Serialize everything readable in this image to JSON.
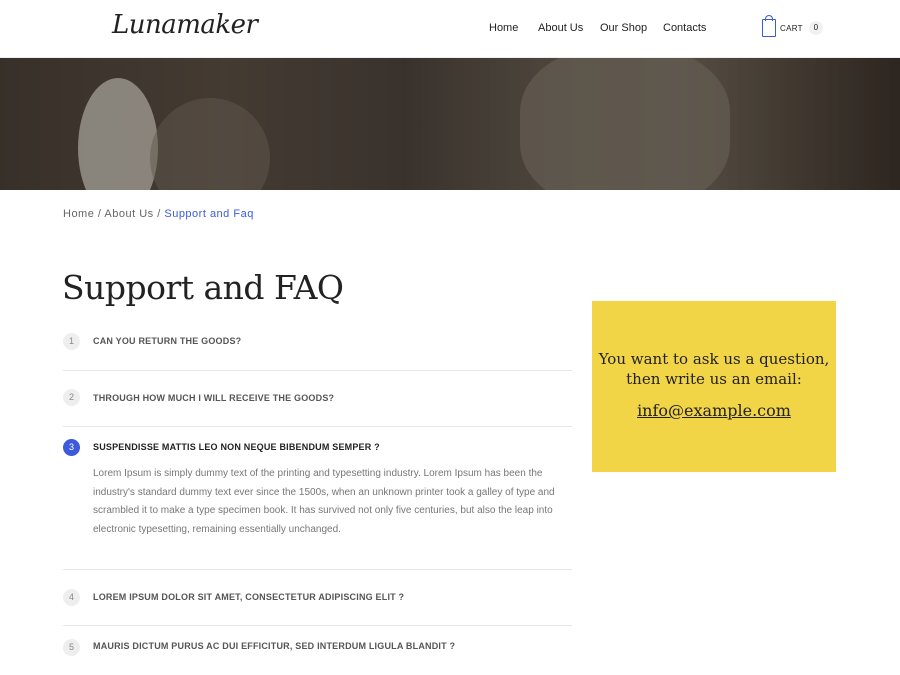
{
  "header": {
    "logo": "Lunamaker",
    "nav": [
      "Home",
      "About Us",
      "Our Shop",
      "Contacts"
    ],
    "cart_label": "CART",
    "cart_count": "0"
  },
  "breadcrumb": {
    "home": "Home",
    "about": "About Us",
    "current": "Support and Faq",
    "separator": "/"
  },
  "page_title": "Support and FAQ",
  "faq": [
    {
      "num": "1",
      "question": "CAN YOU RETURN THE GOODS?"
    },
    {
      "num": "2",
      "question": "THROUGH HOW MUCH I WILL RECEIVE THE GOODS?"
    },
    {
      "num": "3",
      "question": "SUSPENDISSE MATTIS LEO NON NEQUE BIBENDUM SEMPER ?",
      "answer": "Lorem Ipsum is simply dummy text of the printing and typesetting industry. Lorem Ipsum has been the industry's standard dummy text ever since the 1500s, when an unknown printer took a galley of type and scrambled it to make a type specimen book. It has survived not only five centuries, but also the leap into electronic typesetting, remaining essentially unchanged."
    },
    {
      "num": "4",
      "question": "LOREM IPSUM DOLOR SIT AMET, CONSECTETUR ADIPISCING ELIT ?"
    },
    {
      "num": "5",
      "question": "MAURIS DICTUM PURUS AC DUI EFFICITUR, SED INTERDUM LIGULA BLANDIT ?"
    }
  ],
  "contact": {
    "line1": "You want to ask us a question,",
    "line2": "then write us an email:",
    "email": "info@example.com"
  },
  "colors": {
    "accent": "#3b5bdb",
    "contact_bg": "#f2d447"
  }
}
